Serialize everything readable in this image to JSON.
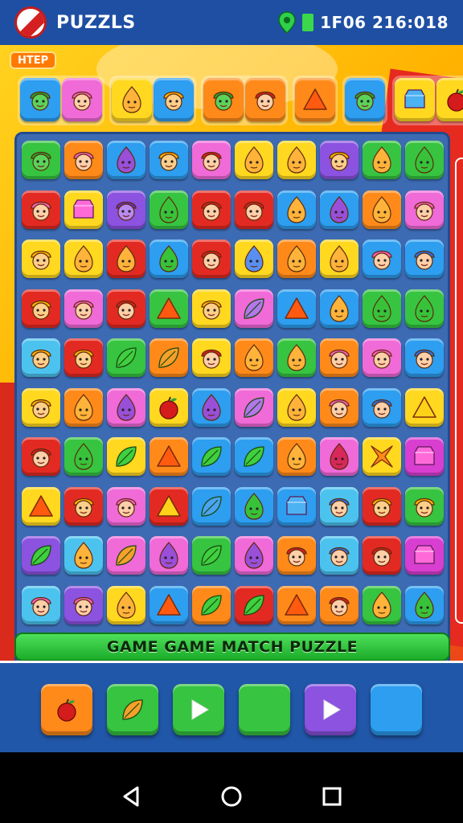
{
  "status": {
    "app_title": "PUZZLS",
    "status_text": "1F06 216:018"
  },
  "help_badge": "HTEP",
  "banner": "GAME GAME MATCH PUZZLE",
  "colors": {
    "red": "#e32a22",
    "orange": "#ff8a1a",
    "yellow": "#ffd81f",
    "green": "#37c441",
    "blue": "#2d9ef0",
    "purple": "#8c52e0",
    "pink": "#f06ad8",
    "magenta": "#d83fd0",
    "lightblue": "#4cc3ef"
  },
  "tray": [
    {
      "items": [
        {
          "c": "blue",
          "k": "face-green"
        },
        {
          "c": "pink",
          "k": "face-pink"
        }
      ]
    },
    {
      "items": [
        {
          "c": "yellow",
          "k": "drop-orange"
        },
        {
          "c": "blue",
          "k": "face"
        }
      ]
    },
    {
      "items": [
        {
          "c": "orange",
          "k": "face-green"
        },
        {
          "c": "orange",
          "k": "face-red"
        }
      ]
    },
    {
      "items": [
        {
          "c": "orange",
          "k": "triangle"
        }
      ]
    },
    {
      "items": [
        {
          "c": "blue",
          "k": "face-green"
        }
      ]
    },
    {
      "items": [
        {
          "c": "yellow",
          "k": "gem-blue"
        },
        {
          "c": "yellow",
          "k": "apple"
        }
      ]
    }
  ],
  "board": [
    [
      {
        "c": "green",
        "k": "face-green"
      },
      {
        "c": "orange",
        "k": "face-pink"
      },
      {
        "c": "blue",
        "k": "drop-purple"
      },
      {
        "c": "blue",
        "k": "face"
      },
      {
        "c": "pink",
        "k": "face-red"
      },
      {
        "c": "yellow",
        "k": "drop-orange"
      },
      {
        "c": "yellow",
        "k": "drop-orange"
      },
      {
        "c": "purple",
        "k": "face"
      },
      {
        "c": "green",
        "k": "drop-orange"
      },
      {
        "c": "green",
        "k": "drop-green"
      }
    ],
    [
      {
        "c": "red",
        "k": "face-pink"
      },
      {
        "c": "yellow",
        "k": "gem-pink"
      },
      {
        "c": "purple",
        "k": "face-purple"
      },
      {
        "c": "green",
        "k": "drop-green"
      },
      {
        "c": "red",
        "k": "face-red"
      },
      {
        "c": "red",
        "k": "face-red"
      },
      {
        "c": "blue",
        "k": "drop-orange"
      },
      {
        "c": "blue",
        "k": "drop-purple"
      },
      {
        "c": "orange",
        "k": "drop-orange"
      },
      {
        "c": "pink",
        "k": "face-pink"
      }
    ],
    [
      {
        "c": "yellow",
        "k": "face"
      },
      {
        "c": "yellow",
        "k": "drop-orange"
      },
      {
        "c": "red",
        "k": "drop-orange"
      },
      {
        "c": "blue",
        "k": "drop-green"
      },
      {
        "c": "red",
        "k": "face-red"
      },
      {
        "c": "yellow",
        "k": "drop-blue"
      },
      {
        "c": "orange",
        "k": "drop-orange"
      },
      {
        "c": "yellow",
        "k": "drop-orange"
      },
      {
        "c": "blue",
        "k": "face-pink"
      },
      {
        "c": "blue",
        "k": "face-blue"
      }
    ],
    [
      {
        "c": "red",
        "k": "face"
      },
      {
        "c": "pink",
        "k": "face-pink"
      },
      {
        "c": "red",
        "k": "face-red"
      },
      {
        "c": "green",
        "k": "triangle"
      },
      {
        "c": "yellow",
        "k": "face"
      },
      {
        "c": "pink",
        "k": "leaf-purple"
      },
      {
        "c": "blue",
        "k": "triangle"
      },
      {
        "c": "blue",
        "k": "drop-orange"
      },
      {
        "c": "green",
        "k": "drop-green"
      },
      {
        "c": "green",
        "k": "drop-green"
      }
    ],
    [
      {
        "c": "lightblue",
        "k": "face"
      },
      {
        "c": "red",
        "k": "face"
      },
      {
        "c": "green",
        "k": "leaf"
      },
      {
        "c": "orange",
        "k": "leaf-orange"
      },
      {
        "c": "yellow",
        "k": "face-red"
      },
      {
        "c": "orange",
        "k": "drop-orange"
      },
      {
        "c": "green",
        "k": "drop-orange"
      },
      {
        "c": "orange",
        "k": "face-pink"
      },
      {
        "c": "pink",
        "k": "face-pink"
      },
      {
        "c": "blue",
        "k": "face-blue"
      }
    ],
    [
      {
        "c": "yellow",
        "k": "face"
      },
      {
        "c": "orange",
        "k": "drop-orange"
      },
      {
        "c": "pink",
        "k": "drop-purple"
      },
      {
        "c": "yellow",
        "k": "apple"
      },
      {
        "c": "blue",
        "k": "drop-purple"
      },
      {
        "c": "pink",
        "k": "leaf-purple"
      },
      {
        "c": "yellow",
        "k": "drop-orange"
      },
      {
        "c": "orange",
        "k": "face-pink"
      },
      {
        "c": "blue",
        "k": "face-blue"
      },
      {
        "c": "yellow",
        "k": "triangle-yellow"
      }
    ],
    [
      {
        "c": "red",
        "k": "face-red"
      },
      {
        "c": "green",
        "k": "drop-green"
      },
      {
        "c": "yellow",
        "k": "leaf"
      },
      {
        "c": "orange",
        "k": "triangle"
      },
      {
        "c": "blue",
        "k": "leaf"
      },
      {
        "c": "blue",
        "k": "leaf"
      },
      {
        "c": "orange",
        "k": "drop-orange"
      },
      {
        "c": "pink",
        "k": "drop-red"
      },
      {
        "c": "yellow",
        "k": "star"
      },
      {
        "c": "magenta",
        "k": "gem-pink"
      }
    ],
    [
      {
        "c": "yellow",
        "k": "triangle"
      },
      {
        "c": "red",
        "k": "face"
      },
      {
        "c": "pink",
        "k": "face-pink"
      },
      {
        "c": "red",
        "k": "triangle-yellow"
      },
      {
        "c": "blue",
        "k": "leaf-blue"
      },
      {
        "c": "blue",
        "k": "drop-green"
      },
      {
        "c": "blue",
        "k": "gem-blue"
      },
      {
        "c": "lightblue",
        "k": "face-blue"
      },
      {
        "c": "red",
        "k": "face"
      },
      {
        "c": "green",
        "k": "face"
      }
    ],
    [
      {
        "c": "purple",
        "k": "leaf"
      },
      {
        "c": "lightblue",
        "k": "drop-orange"
      },
      {
        "c": "pink",
        "k": "leaf-orange"
      },
      {
        "c": "pink",
        "k": "drop-purple"
      },
      {
        "c": "green",
        "k": "leaf"
      },
      {
        "c": "pink",
        "k": "drop-purple"
      },
      {
        "c": "orange",
        "k": "face-red"
      },
      {
        "c": "lightblue",
        "k": "face-blue"
      },
      {
        "c": "red",
        "k": "face-red"
      },
      {
        "c": "magenta",
        "k": "gem-pink"
      }
    ],
    [
      {
        "c": "lightblue",
        "k": "face-pink"
      },
      {
        "c": "purple",
        "k": "face-pink"
      },
      {
        "c": "yellow",
        "k": "drop-orange"
      },
      {
        "c": "blue",
        "k": "triangle"
      },
      {
        "c": "orange",
        "k": "leaf"
      },
      {
        "c": "red",
        "k": "leaf"
      },
      {
        "c": "orange",
        "k": "triangle"
      },
      {
        "c": "orange",
        "k": "face-red"
      },
      {
        "c": "green",
        "k": "drop-orange"
      },
      {
        "c": "blue",
        "k": "drop-green"
      }
    ],
    [
      {
        "c": "red",
        "k": "gem-pink"
      },
      {
        "c": "red",
        "k": "triangle-yellow"
      },
      {
        "c": "orange",
        "k": "leaf"
      },
      {
        "c": "green",
        "k": "triangle-yellow"
      },
      {
        "c": "orange",
        "k": "face-red"
      },
      {
        "c": "yellow",
        "k": "drop-green"
      },
      {
        "c": "red",
        "k": "face"
      },
      {
        "c": "green",
        "k": "face-green"
      },
      {
        "c": "green",
        "k": "face-blue"
      },
      {
        "c": "lightblue",
        "k": "gem-blue"
      }
    ]
  ],
  "actions": [
    {
      "c": "orange",
      "k": "apple"
    },
    {
      "c": "green",
      "k": "leaf-orange"
    },
    {
      "c": "green",
      "k": "play"
    },
    {
      "c": "green",
      "k": "blank"
    },
    {
      "c": "purple",
      "k": "play"
    },
    {
      "c": "blue",
      "k": "blank"
    }
  ]
}
